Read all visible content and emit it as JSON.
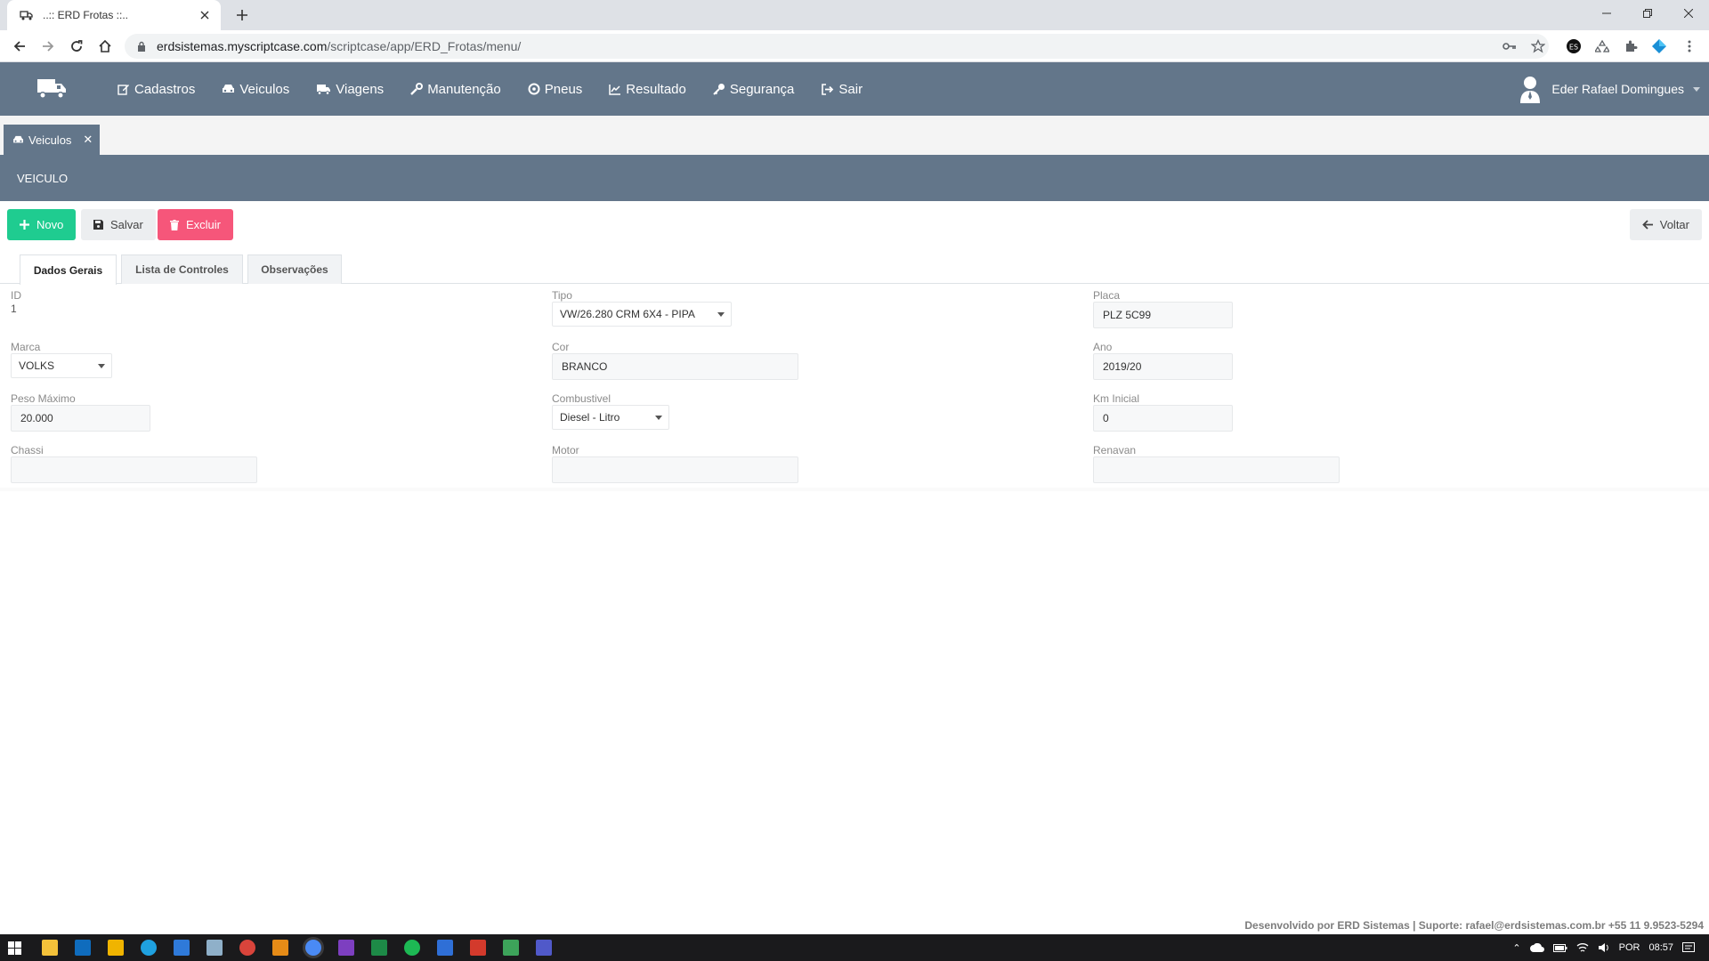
{
  "browser": {
    "tab_title": "..:: ERD Frotas ::..",
    "url_host": "erdsistemas.myscriptcase.com",
    "url_path": "/scriptcase/app/ERD_Frotas/menu/"
  },
  "navbar": {
    "menu": [
      {
        "label": "Cadastros",
        "icon": "edit-icon"
      },
      {
        "label": "Veiculos",
        "icon": "car-icon"
      },
      {
        "label": "Viagens",
        "icon": "truck-icon"
      },
      {
        "label": "Manutenção",
        "icon": "wrench-icon"
      },
      {
        "label": "Pneus",
        "icon": "tire-icon"
      },
      {
        "label": "Resultado",
        "icon": "chart-icon"
      },
      {
        "label": "Segurança",
        "icon": "key-icon"
      },
      {
        "label": "Sair",
        "icon": "sign-out-icon"
      }
    ],
    "user_name": "Eder Rafael Domingues"
  },
  "app_tab": {
    "label": "Veiculos"
  },
  "page": {
    "title": "VEICULO"
  },
  "toolbar": {
    "novo": "Novo",
    "salvar": "Salvar",
    "excluir": "Excluir",
    "voltar": "Voltar"
  },
  "form_tabs": [
    "Dados Gerais",
    "Lista de Controles",
    "Observações"
  ],
  "form": {
    "id": {
      "label": "ID",
      "value": "1"
    },
    "tipo": {
      "label": "Tipo",
      "value": "VW/26.280 CRM 6X4 - PIPA"
    },
    "placa": {
      "label": "Placa",
      "value": "PLZ 5C99"
    },
    "marca": {
      "label": "Marca",
      "value": "VOLKS"
    },
    "cor": {
      "label": "Cor",
      "value": "BRANCO"
    },
    "ano": {
      "label": "Ano",
      "value": "2019/20"
    },
    "peso": {
      "label": "Peso Máximo",
      "value": "20.000"
    },
    "combustivel": {
      "label": "Combustivel",
      "value": "Diesel - Litro"
    },
    "km": {
      "label": "Km Inicial",
      "value": "0"
    },
    "chassi": {
      "label": "Chassi",
      "value": ""
    },
    "motor": {
      "label": "Motor",
      "value": ""
    },
    "renavan": {
      "label": "Renavan",
      "value": ""
    }
  },
  "footer": {
    "text": "Desenvolvido por ERD Sistemas | Suporte: rafael@erdsistemas.com.br +55 11 9.9523-5294"
  },
  "taskbar": {
    "lang": "POR",
    "time": "08:57"
  },
  "colors": {
    "nav": "#63768a",
    "novo": "#1fcc90",
    "excluir": "#f6567a"
  }
}
